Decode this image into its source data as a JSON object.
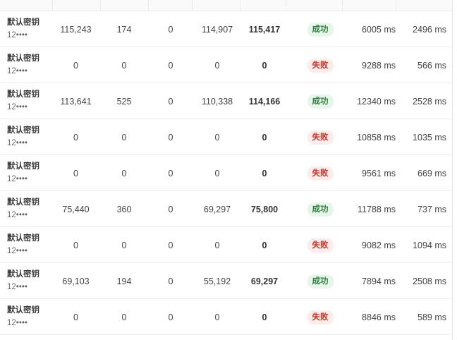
{
  "colors": {
    "success_bg": "#e8f5ea",
    "success_text": "#2e7d3e",
    "fail_bg": "#fdeceb",
    "fail_text": "#c0392b"
  },
  "rows": [
    {
      "key_name": "默认密钥",
      "key_mask": "12••••",
      "v1": "115,243",
      "v2": "174",
      "v3": "0",
      "v4": "114,907",
      "v5": "115,417",
      "status": "成功",
      "status_type": "ok",
      "t1": "6005 ms",
      "t2": "2496 ms"
    },
    {
      "key_name": "默认密钥",
      "key_mask": "12••••",
      "v1": "0",
      "v2": "0",
      "v3": "0",
      "v4": "0",
      "v5": "0",
      "status": "失败",
      "status_type": "fail",
      "t1": "9288 ms",
      "t2": "566 ms"
    },
    {
      "key_name": "默认密钥",
      "key_mask": "12••••",
      "v1": "113,641",
      "v2": "525",
      "v3": "0",
      "v4": "110,338",
      "v5": "114,166",
      "status": "成功",
      "status_type": "ok",
      "t1": "12340 ms",
      "t2": "2528 ms"
    },
    {
      "key_name": "默认密钥",
      "key_mask": "12••••",
      "v1": "0",
      "v2": "0",
      "v3": "0",
      "v4": "0",
      "v5": "0",
      "status": "失败",
      "status_type": "fail",
      "t1": "10858 ms",
      "t2": "1035 ms"
    },
    {
      "key_name": "默认密钥",
      "key_mask": "12••••",
      "v1": "0",
      "v2": "0",
      "v3": "0",
      "v4": "0",
      "v5": "0",
      "status": "失败",
      "status_type": "fail",
      "t1": "9561 ms",
      "t2": "669 ms"
    },
    {
      "key_name": "默认密钥",
      "key_mask": "12••••",
      "v1": "75,440",
      "v2": "360",
      "v3": "0",
      "v4": "69,297",
      "v5": "75,800",
      "status": "成功",
      "status_type": "ok",
      "t1": "11788 ms",
      "t2": "737 ms"
    },
    {
      "key_name": "默认密钥",
      "key_mask": "12••••",
      "v1": "0",
      "v2": "0",
      "v3": "0",
      "v4": "0",
      "v5": "0",
      "status": "失败",
      "status_type": "fail",
      "t1": "9082 ms",
      "t2": "1094 ms"
    },
    {
      "key_name": "默认密钥",
      "key_mask": "12••••",
      "v1": "69,103",
      "v2": "194",
      "v3": "0",
      "v4": "55,192",
      "v5": "69,297",
      "status": "成功",
      "status_type": "ok",
      "t1": "7894 ms",
      "t2": "2508 ms"
    },
    {
      "key_name": "默认密钥",
      "key_mask": "12••••",
      "v1": "0",
      "v2": "0",
      "v3": "0",
      "v4": "0",
      "v5": "0",
      "status": "失败",
      "status_type": "fail",
      "t1": "8846 ms",
      "t2": "589 ms"
    }
  ]
}
